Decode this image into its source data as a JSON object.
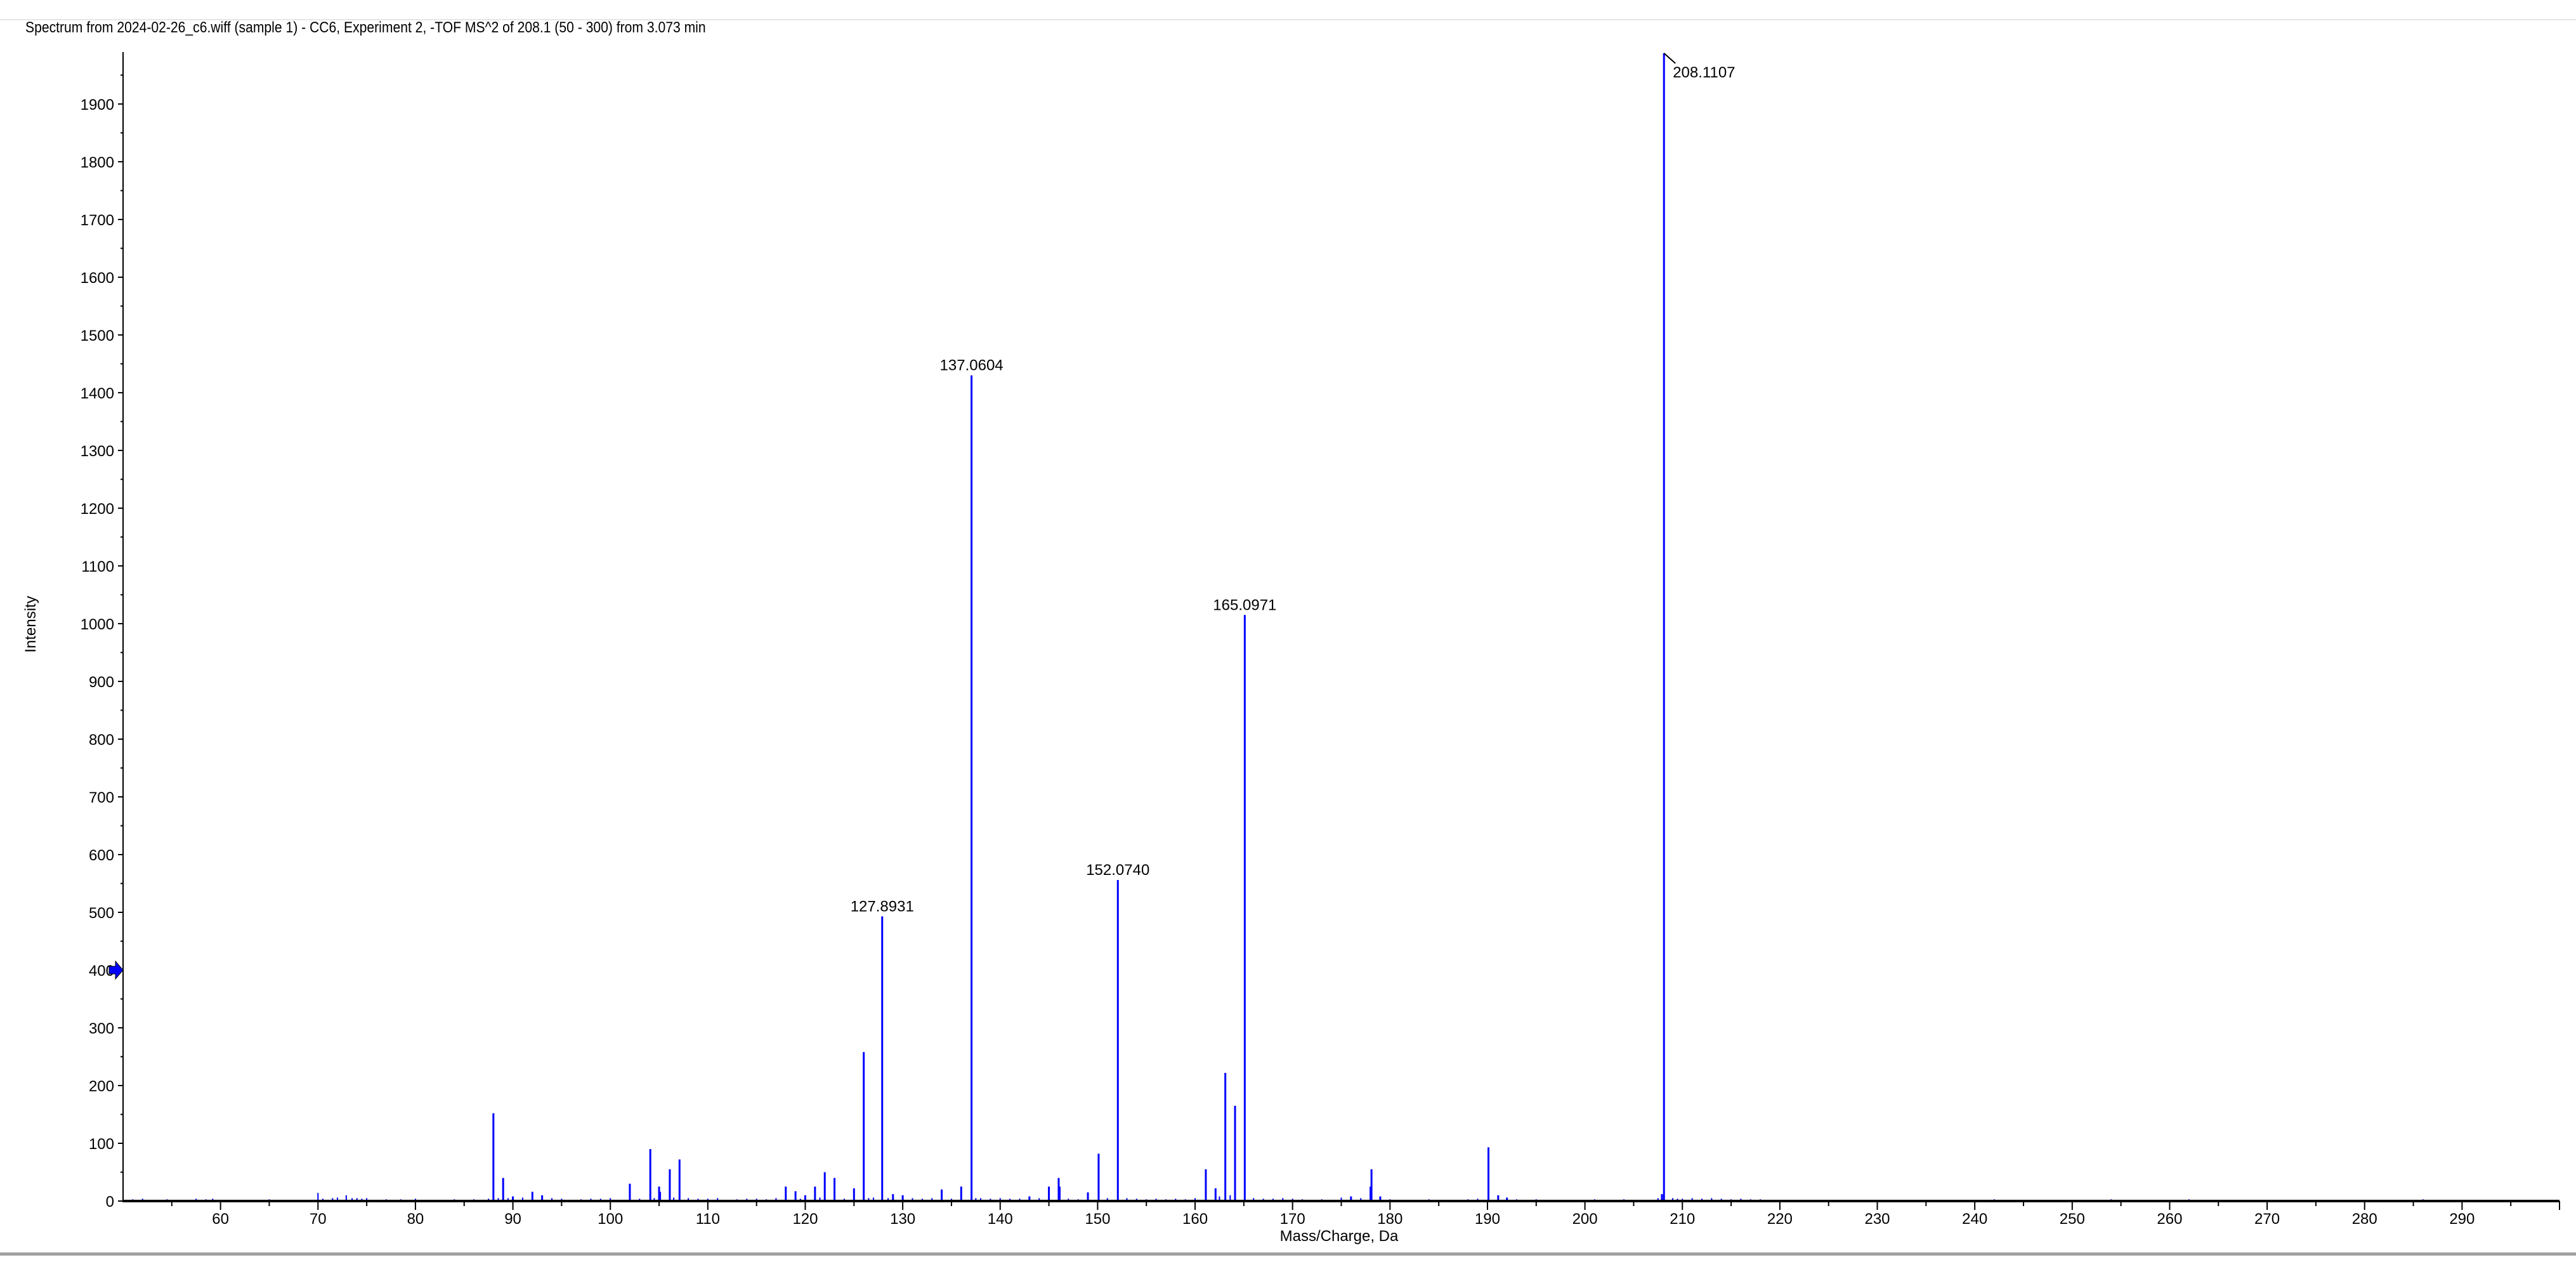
{
  "window": {
    "title": "Spectrum from 2024-02-26_c6.wiff (sample 1) - CC6, Experiment 2, -TOF MS^2 of 208.1 (50 - 300) from 3.073 min"
  },
  "chart_data": {
    "type": "bar",
    "title": "Spectrum from 2024-02-26_c6.wiff (sample 1) - CC6, Experiment 2, -TOF MS^2 of 208.1 (50 - 300) from 3.073 min",
    "xlabel": "Mass/Charge, Da",
    "ylabel": "Intensity",
    "xlim": [
      50,
      300
    ],
    "ylim": [
      0,
      1990
    ],
    "xticks": [
      60,
      70,
      80,
      90,
      100,
      110,
      120,
      130,
      140,
      150,
      160,
      170,
      180,
      190,
      200,
      210,
      220,
      230,
      240,
      250,
      260,
      270,
      280,
      290
    ],
    "yticks": [
      0,
      100,
      200,
      300,
      400,
      500,
      600,
      700,
      800,
      900,
      1000,
      1100,
      1200,
      1300,
      1400,
      1500,
      1600,
      1700,
      1800,
      1900
    ],
    "bar_color": "#0000ff",
    "marker": {
      "y": 400,
      "color": "#0000ff"
    },
    "peaks": [
      {
        "mz": 88.0,
        "intensity": 152
      },
      {
        "mz": 89.0,
        "intensity": 40
      },
      {
        "mz": 90.0,
        "intensity": 8
      },
      {
        "mz": 92.0,
        "intensity": 16
      },
      {
        "mz": 93.0,
        "intensity": 10
      },
      {
        "mz": 102.0,
        "intensity": 30
      },
      {
        "mz": 104.1,
        "intensity": 90
      },
      {
        "mz": 105.0,
        "intensity": 25
      },
      {
        "mz": 105.1,
        "intensity": 16
      },
      {
        "mz": 106.1,
        "intensity": 55
      },
      {
        "mz": 107.1,
        "intensity": 72
      },
      {
        "mz": 118.0,
        "intensity": 25
      },
      {
        "mz": 119.0,
        "intensity": 17
      },
      {
        "mz": 120.0,
        "intensity": 10
      },
      {
        "mz": 121.0,
        "intensity": 25
      },
      {
        "mz": 122.0,
        "intensity": 50
      },
      {
        "mz": 123.0,
        "intensity": 40
      },
      {
        "mz": 125.0,
        "intensity": 22
      },
      {
        "mz": 126.0,
        "intensity": 258
      },
      {
        "mz": 127.8931,
        "intensity": 493,
        "label": "127.8931"
      },
      {
        "mz": 129.0,
        "intensity": 12
      },
      {
        "mz": 130.0,
        "intensity": 10
      },
      {
        "mz": 134.0,
        "intensity": 20
      },
      {
        "mz": 136.0,
        "intensity": 25
      },
      {
        "mz": 137.0604,
        "intensity": 1430,
        "label": "137.0604"
      },
      {
        "mz": 143.0,
        "intensity": 8
      },
      {
        "mz": 145.0,
        "intensity": 25
      },
      {
        "mz": 146.0,
        "intensity": 40
      },
      {
        "mz": 146.1,
        "intensity": 25
      },
      {
        "mz": 149.0,
        "intensity": 15
      },
      {
        "mz": 150.1,
        "intensity": 82
      },
      {
        "mz": 152.074,
        "intensity": 556,
        "label": "152.0740"
      },
      {
        "mz": 161.1,
        "intensity": 55
      },
      {
        "mz": 162.1,
        "intensity": 22
      },
      {
        "mz": 163.1,
        "intensity": 222
      },
      {
        "mz": 164.1,
        "intensity": 165
      },
      {
        "mz": 165.0971,
        "intensity": 1015,
        "label": "165.0971"
      },
      {
        "mz": 176.0,
        "intensity": 8
      },
      {
        "mz": 178.0,
        "intensity": 25
      },
      {
        "mz": 178.1,
        "intensity": 55
      },
      {
        "mz": 179.0,
        "intensity": 8
      },
      {
        "mz": 190.1,
        "intensity": 93
      },
      {
        "mz": 191.1,
        "intensity": 10
      },
      {
        "mz": 192.0,
        "intensity": 6
      },
      {
        "mz": 207.9,
        "intensity": 12
      },
      {
        "mz": 208.1107,
        "intensity": 1988,
        "label": "208.1107"
      }
    ],
    "noise": [
      [
        51,
        3
      ],
      [
        52,
        4
      ],
      [
        53,
        2
      ],
      [
        54.5,
        3
      ],
      [
        56,
        2
      ],
      [
        57.5,
        4
      ],
      [
        58.5,
        3
      ],
      [
        59.2,
        4
      ],
      [
        61,
        2
      ],
      [
        65,
        3
      ],
      [
        66,
        2
      ],
      [
        70,
        14
      ],
      [
        70.5,
        4
      ],
      [
        71.5,
        5
      ],
      [
        72,
        6
      ],
      [
        72.9,
        10
      ],
      [
        73.5,
        5
      ],
      [
        74,
        5
      ],
      [
        74.5,
        4
      ],
      [
        75,
        5
      ],
      [
        77,
        3
      ],
      [
        78.5,
        3
      ],
      [
        80,
        4
      ],
      [
        82,
        2
      ],
      [
        84,
        3
      ],
      [
        86,
        3
      ],
      [
        87.5,
        4
      ],
      [
        88.5,
        5
      ],
      [
        89.5,
        5
      ],
      [
        91,
        6
      ],
      [
        94,
        5
      ],
      [
        95,
        4
      ],
      [
        97,
        3
      ],
      [
        98,
        4
      ],
      [
        99,
        4
      ],
      [
        100,
        5
      ],
      [
        103,
        4
      ],
      [
        104.5,
        5
      ],
      [
        106.5,
        6
      ],
      [
        108,
        5
      ],
      [
        109,
        4
      ],
      [
        110,
        4
      ],
      [
        111,
        5
      ],
      [
        113,
        3
      ],
      [
        114,
        4
      ],
      [
        115,
        4
      ],
      [
        116,
        3
      ],
      [
        117,
        5
      ],
      [
        119.5,
        4
      ],
      [
        121.5,
        6
      ],
      [
        124,
        4
      ],
      [
        126.5,
        5
      ],
      [
        127,
        6
      ],
      [
        128.5,
        5
      ],
      [
        131,
        5
      ],
      [
        132,
        4
      ],
      [
        133,
        5
      ],
      [
        135,
        4
      ],
      [
        137.5,
        5
      ],
      [
        138,
        5
      ],
      [
        139,
        4
      ],
      [
        140,
        5
      ],
      [
        141,
        4
      ],
      [
        142,
        4
      ],
      [
        144,
        5
      ],
      [
        147,
        4
      ],
      [
        148,
        3
      ],
      [
        151,
        5
      ],
      [
        153,
        5
      ],
      [
        154,
        4
      ],
      [
        155,
        3
      ],
      [
        156,
        4
      ],
      [
        157,
        3
      ],
      [
        158,
        4
      ],
      [
        159,
        3
      ],
      [
        160,
        5
      ],
      [
        162.5,
        8
      ],
      [
        163.6,
        10
      ],
      [
        166,
        5
      ],
      [
        167,
        4
      ],
      [
        168,
        4
      ],
      [
        169,
        5
      ],
      [
        170,
        4
      ],
      [
        171,
        3
      ],
      [
        173,
        3
      ],
      [
        175,
        6
      ],
      [
        177,
        5
      ],
      [
        180,
        3
      ],
      [
        184,
        3
      ],
      [
        188,
        3
      ],
      [
        189,
        4
      ],
      [
        193,
        3
      ],
      [
        194,
        2
      ],
      [
        195,
        3
      ],
      [
        196,
        2
      ],
      [
        199,
        2
      ],
      [
        201,
        3
      ],
      [
        204,
        3
      ],
      [
        206,
        2
      ],
      [
        207.5,
        5
      ],
      [
        209,
        5
      ],
      [
        209.5,
        4
      ],
      [
        210,
        4
      ],
      [
        211,
        5
      ],
      [
        212,
        4
      ],
      [
        213,
        5
      ],
      [
        214,
        4
      ],
      [
        215,
        3
      ],
      [
        216,
        4
      ],
      [
        217,
        3
      ],
      [
        218,
        3
      ],
      [
        219,
        2
      ],
      [
        222,
        2
      ],
      [
        242,
        3
      ],
      [
        254,
        3
      ],
      [
        262,
        3
      ],
      [
        286,
        3
      ]
    ]
  }
}
